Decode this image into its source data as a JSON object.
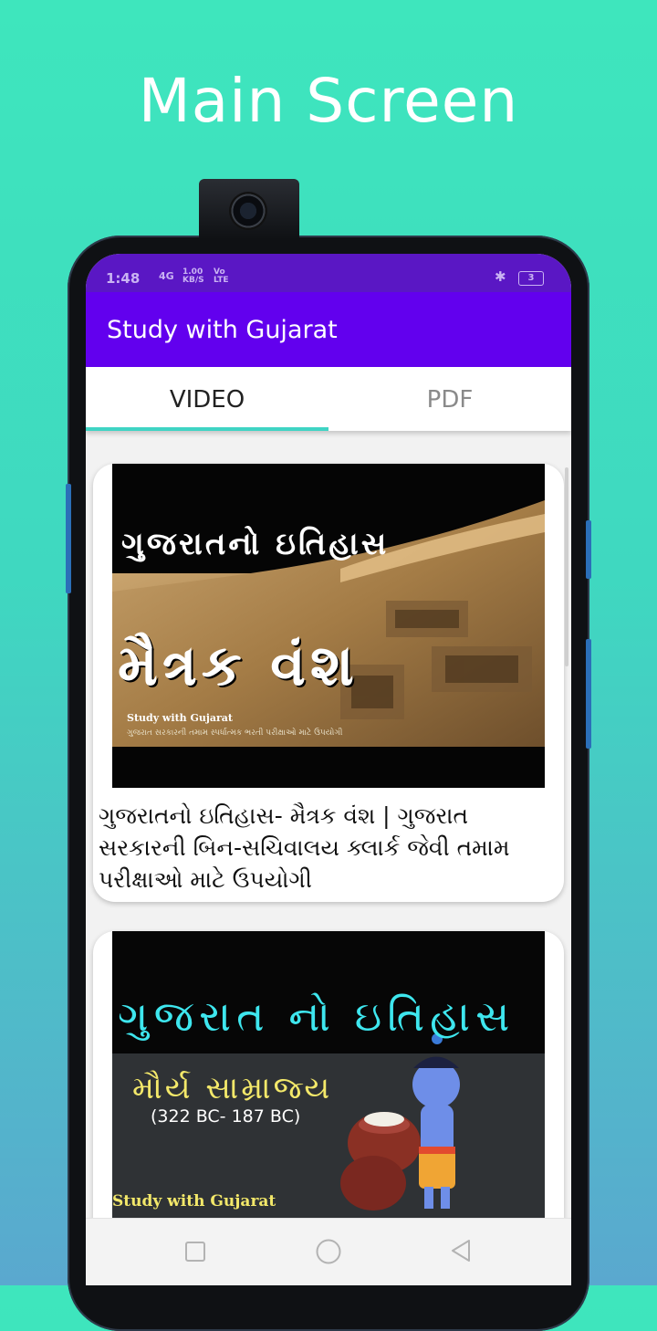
{
  "headline": "Main Screen",
  "status_bar": {
    "time": "1:48",
    "network": "4G",
    "speed_value": "1.00",
    "speed_unit": "KB/S",
    "volte": "Vo LTE",
    "battery": "3"
  },
  "app_bar": {
    "title": "Study with Gujarat"
  },
  "tabs": [
    {
      "label": "VIDEO",
      "selected": true
    },
    {
      "label": "PDF",
      "selected": false
    }
  ],
  "videos": [
    {
      "thumbnail": {
        "title_line": "ગુજરાતનો ઇતિહાસ",
        "big_text": "મૈત્રક વંશ",
        "channel": "Study with Gujarat",
        "tagline": "ગુજરાત સરકારની તમામ સ્પર્ધાત્મક ભરતી પરીક્ષાઓ માટે ઉપયોગી"
      },
      "caption": "ગુજરાતનો ઇતિહાસ- મૈત્રક વંશ  | ગુજરાત સરકારની  બિન-સચિવાલય ક્લાર્ક જેવી તમામ પરીક્ષાઓ માટે ઉપયોગી"
    },
    {
      "thumbnail": {
        "title_line": "ગુજરાત નો ઇતિહાસ",
        "subtitle": "મૌર્ય સામ્રાજ્ય",
        "years": "(322 BC- 187 BC)",
        "channel": "Study with Gujarat"
      }
    }
  ],
  "colors": {
    "primary": "#6200ee",
    "status_bar": "#5a17c4",
    "tab_indicator": "#3fd4c4",
    "background_top": "#3ee6bd",
    "background_bottom": "#5aa8cf"
  },
  "icons": {
    "bluetooth": "bluetooth-icon",
    "nav_recent": "square-icon",
    "nav_home": "circle-icon",
    "nav_back": "triangle-back-icon"
  }
}
